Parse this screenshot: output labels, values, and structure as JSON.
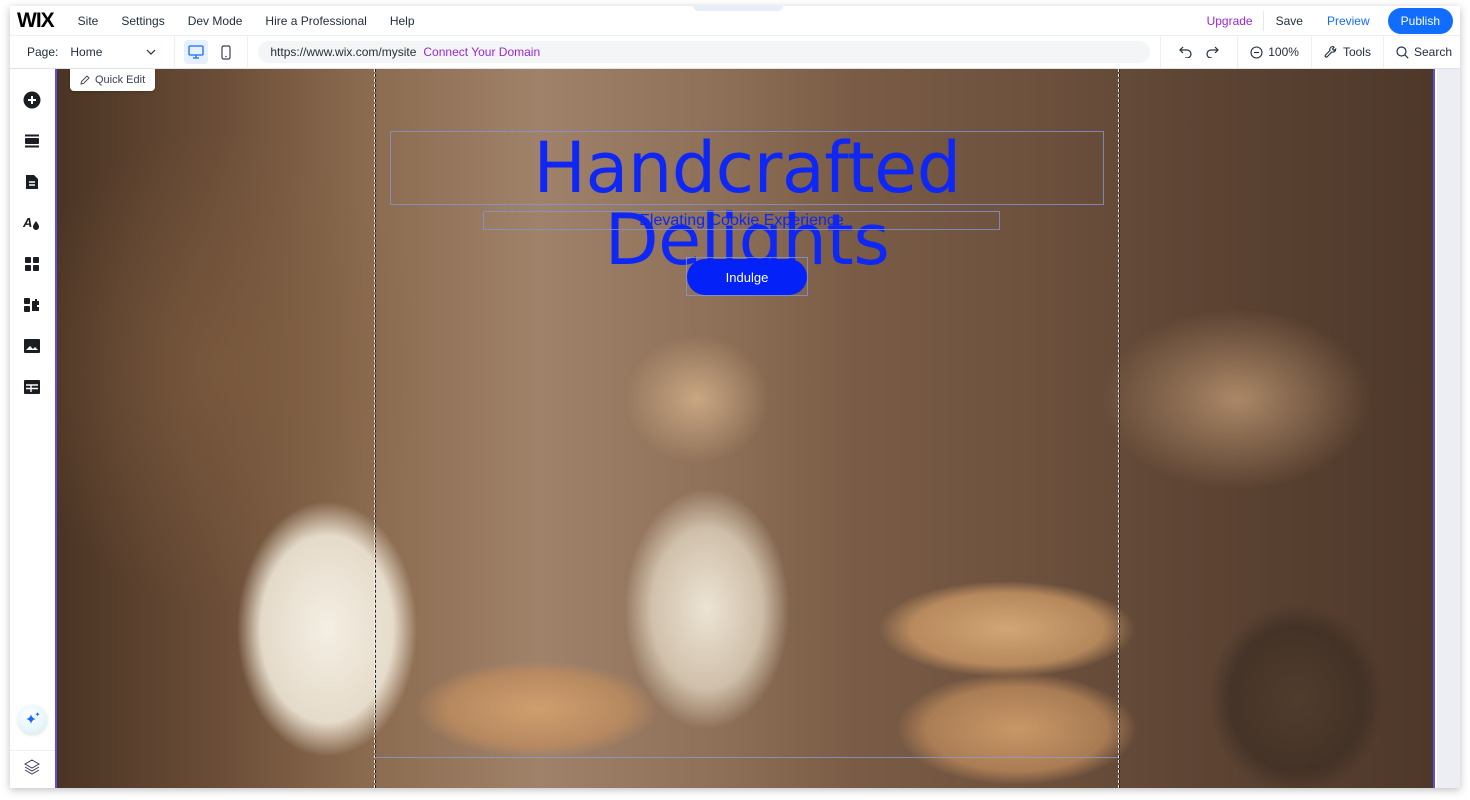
{
  "menubar": {
    "logo": "WIX",
    "items": [
      "Site",
      "Settings",
      "Dev Mode",
      "Hire a Professional",
      "Help"
    ],
    "upgrade": "Upgrade",
    "save": "Save",
    "preview": "Preview",
    "publish": "Publish"
  },
  "toolbar": {
    "page_label": "Page:",
    "page_value": "Home",
    "url": "https://www.wix.com/mysite",
    "connect_domain": "Connect Your Domain",
    "zoom": "100%",
    "tools": "Tools",
    "search": "Search"
  },
  "sidebar": {
    "items": [
      "add-elements",
      "add-section",
      "pages-and-menu",
      "site-design",
      "add-apps",
      "business-apps",
      "media",
      "cms"
    ],
    "ai_assistant": "ai-assistant",
    "layers": "layers"
  },
  "canvas": {
    "quick_edit": "Quick Edit",
    "headline": "Handcrafted Delights",
    "subtitle": "Elevating Cookie Experience",
    "cta": "Indulge"
  },
  "colors": {
    "accent": "#116dff",
    "upgrade": "#9a27d5",
    "headline": "#0f27f5",
    "button": "#0422f7",
    "selection": "#5b4de8"
  }
}
